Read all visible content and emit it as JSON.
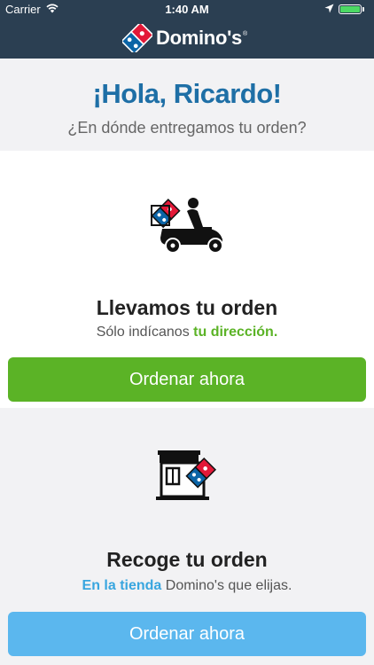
{
  "status_bar": {
    "carrier": "Carrier",
    "time": "1:40 AM"
  },
  "header": {
    "brand": "Domino's",
    "brand_mark": "®"
  },
  "greeting": {
    "title": "¡Hola, Ricardo!",
    "subtitle": "¿En dónde entregamos tu orden?"
  },
  "delivery": {
    "title": "Llevamos tu orden",
    "subtitle_prefix": "Sólo indícanos ",
    "subtitle_highlight": "tu dirección.",
    "button_label": "Ordenar ahora"
  },
  "pickup": {
    "title": "Recoge tu orden",
    "subtitle_highlight": "En la tienda",
    "subtitle_suffix": " Domino's que elijas.",
    "button_label": "Ordenar ahora"
  },
  "icons": [
    "wifi-icon",
    "location-icon",
    "battery-icon",
    "dominos-logo-icon",
    "delivery-scooter-icon",
    "store-icon"
  ],
  "colors": {
    "header": "#2b3f52",
    "title_blue": "#1e6fa6",
    "green": "#5bb326",
    "light_blue": "#5bb7ee",
    "dominos_red": "#e31837"
  }
}
